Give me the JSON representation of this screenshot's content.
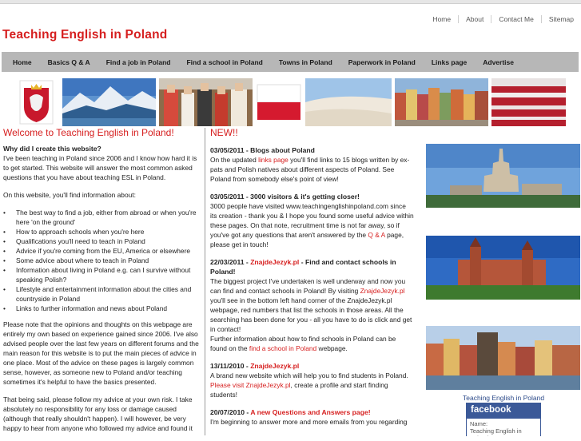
{
  "toplinks": [
    "Home",
    "About",
    "Contact Me",
    "Sitemap"
  ],
  "site_title": "Teaching English in Poland",
  "nav": [
    "Home",
    "Basics Q & A",
    "Find a job in Poland",
    "Find a school in Poland",
    "Towns in Poland",
    "Paperwork in Poland",
    "Links page",
    "Advertise"
  ],
  "left": {
    "heading": "Welcome to Teaching English in Poland!",
    "why_title": "Why did I create this website?",
    "why_text": "I've been teaching in Poland since 2006 and I know how hard it is to get started. This website will answer the most common asked questions that you have about teaching ESL in Poland.",
    "info_intro": "On this website, you'll find information about:",
    "bullets": [
      "The best way to find a job, either from abroad or when you're here 'on the ground'",
      "How to approach schools when you're here",
      "Qualifications you'll need to teach in Poland",
      "Advice if you're coming from the EU, America or elsewhere",
      "Some advice about where to teach in Poland",
      "Information about living in Poland e.g. can I survive without speaking Polish?",
      "Lifestyle and entertainment information about the cities and countryside in Poland",
      "Links to further information and news about Poland"
    ],
    "note": "Please note that the opinions and thoughts on this webpage are entirely my own based on experience gained since 2006. I've also advised people over the last few years on different forums and the main reason for this website is to put the main pieces of advice in one place. Most of the advice on these pages is largely common sense, however, as someone new to Poland and/or teaching sometimes it's helpful to have the basics presented.",
    "disclaimer": "That being said, please follow my advice at your own risk. I take absolutely no responsibility for any loss or damage caused (although that really shouldn't happen). I will however, be very happy to hear from anyone who followed my advice and found it"
  },
  "mid": {
    "heading": "NEW!!",
    "n1_title": "03/05/2011 - Blogs about Poland",
    "n1_a": "On the updated ",
    "n1_link": "links page",
    "n1_b": " you'll find links to 15 blogs written by ex-pats and Polish natives about different aspects of Poland. See Poland from somebody else's point of view!",
    "n2_title": "03/05/2011 - 3000 visitors & it's getting closer!",
    "n2_a": "3000 people have visited www.teachingenglishinpoland.com since its creation - thank you & I hope you found some useful advice within these pages. On that note, recruitment time is not far away, so if you've got any questions that aren't answered by the ",
    "n2_link": "Q & A",
    "n2_b": " page, please get in touch!",
    "n3_date": "22/03/2011 - ",
    "n3_link": "ZnajdeJezyk.pl",
    "n3_rest": " - Find and contact schools in Poland!",
    "n3_a": "The biggest project I've undertaken is well underway and now you can find and contact schools in Poland! By visiting ",
    "n3_link2": "ZnajdeJezyk.pl",
    "n3_b": " you'll see in the bottom left hand corner of the ZnajdeJezyk.pl webpage, red numbers that list the schools in those areas. All the searching has been done for you - all you have to do is click and get in contact!",
    "n3_c": "Further information about how to find schools in Poland can be found on the ",
    "n3_link3": "find a school in Poland",
    "n3_d": " webpage.",
    "n4_date": "13/11/2010 - ",
    "n4_link": "ZnajdeJezyk.pl",
    "n4_a": "A brand new website which will help you to find students in Poland. ",
    "n4_link2": "Please visit ZnajdeJezyk.pl",
    "n4_b": ", create a profile and start finding students!",
    "n5_date": "20/07/2010 - ",
    "n5_link": "A new Questions and Answers page!",
    "n5_a": "I'm beginning to answer more and more emails from you regarding"
  },
  "right": {
    "fb_caption": "Teaching English in Poland",
    "fb_logo": "facebook",
    "fb_name_label": "Name:",
    "fb_name_value": "Teaching English in Poland"
  },
  "colors": {
    "accent": "#d61f1f",
    "nav_bg": "#b7b7b7",
    "facebook": "#3b5998"
  }
}
